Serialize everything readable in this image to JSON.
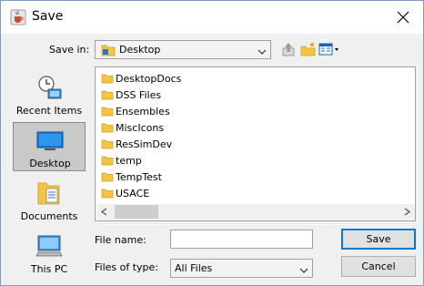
{
  "window": {
    "title": "Save"
  },
  "toolbar": {
    "save_in_label": "Save in:",
    "save_in_value": "Desktop",
    "icons": [
      "up-one-level-icon",
      "create-new-folder-icon",
      "view-menu-icon"
    ]
  },
  "places": [
    {
      "label": "Recent Items",
      "icon": "recent-items-icon",
      "selected": false
    },
    {
      "label": "Desktop",
      "icon": "desktop-icon",
      "selected": true
    },
    {
      "label": "Documents",
      "icon": "documents-icon",
      "selected": false
    },
    {
      "label": "This PC",
      "icon": "computer-icon",
      "selected": false
    }
  ],
  "files": [
    {
      "name": "DesktopDocs"
    },
    {
      "name": "DSS Files"
    },
    {
      "name": "Ensembles"
    },
    {
      "name": "MiscIcons"
    },
    {
      "name": "ResSimDev"
    },
    {
      "name": "temp"
    },
    {
      "name": "TempTest"
    },
    {
      "name": "USACE"
    }
  ],
  "form": {
    "file_name_label": "File name:",
    "file_name_value": "",
    "files_of_type_label": "Files of type:",
    "files_of_type_value": "All Files"
  },
  "buttons": {
    "save": "Save",
    "cancel": "Cancel"
  },
  "colors": {
    "folder": "#f5c542",
    "accent": "#0078d7",
    "title_bar": "#ffffff"
  }
}
